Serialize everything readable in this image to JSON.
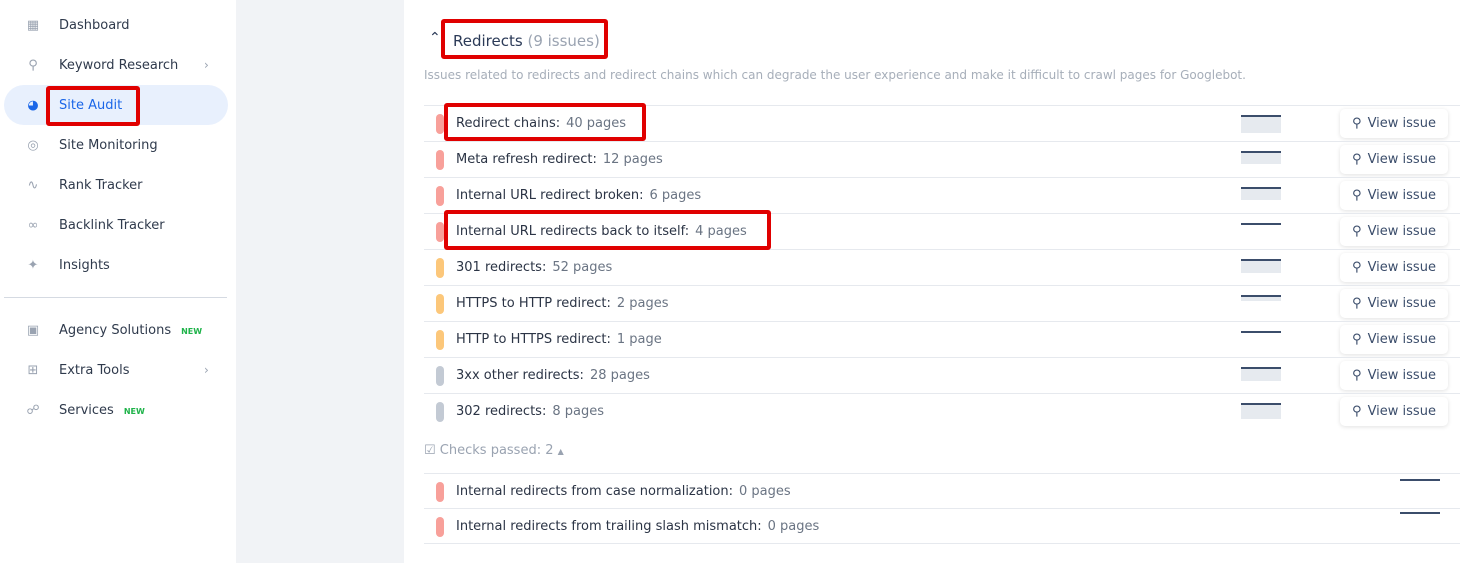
{
  "sidebar": {
    "items": [
      {
        "label": "Dashboard",
        "icon": "dashboard-icon"
      },
      {
        "label": "Keyword Research",
        "icon": "keyword-research-icon",
        "chevron": true
      },
      {
        "label": "Site Audit",
        "icon": "gauge-icon",
        "active": true
      },
      {
        "label": "Site Monitoring",
        "icon": "radar-icon"
      },
      {
        "label": "Rank Tracker",
        "icon": "trend-line-icon"
      },
      {
        "label": "Backlink Tracker",
        "icon": "link-icon"
      },
      {
        "label": "Insights",
        "icon": "magic-wand-icon"
      },
      {
        "label": "Agency Solutions",
        "icon": "briefcase-icon",
        "badge": "NEW"
      },
      {
        "label": "Extra Tools",
        "icon": "grid-plus-icon",
        "chevron": true
      },
      {
        "label": "Services",
        "icon": "nodes-icon",
        "badge": "NEW"
      }
    ]
  },
  "section": {
    "title": "Redirects",
    "count": "(9 issues)",
    "description": "Issues related to redirects and redirect chains which can degrade the user experience and make it difficult to crawl pages for Googlebot.",
    "view_label": "View issue",
    "passed_label": "Checks passed: 2"
  },
  "colors": {
    "error": "#f8a09a",
    "warning": "#fcc77a",
    "notice": "#c3cad4",
    "accent": "#1a66e8",
    "highlight": "#e00000"
  },
  "issues": [
    {
      "name": "Redirect chains:",
      "pages": "40 pages",
      "severity": "error",
      "trend": 1.0
    },
    {
      "name": "Meta refresh redirect:",
      "pages": "12 pages",
      "severity": "error",
      "trend": 0.7
    },
    {
      "name": "Internal URL redirect broken:",
      "pages": "6 pages",
      "severity": "error",
      "trend": 0.7
    },
    {
      "name": "Internal URL redirects back to itself:",
      "pages": "4 pages",
      "severity": "error",
      "trend": 0.0
    },
    {
      "name": "301 redirects:",
      "pages": "52 pages",
      "severity": "warning",
      "trend": 0.8
    },
    {
      "name": "HTTPS to HTTP redirect:",
      "pages": "2 pages",
      "severity": "warning",
      "trend": 0.35
    },
    {
      "name": "HTTP to HTTPS redirect:",
      "pages": "1 page",
      "severity": "warning",
      "trend": 0.1
    },
    {
      "name": "3xx other redirects:",
      "pages": "28 pages",
      "severity": "notice",
      "trend": 0.8
    },
    {
      "name": "302 redirects:",
      "pages": "8 pages",
      "severity": "notice",
      "trend": 0.9
    }
  ],
  "passed": [
    {
      "name": "Internal redirects from case normalization:",
      "pages": "0 pages",
      "severity": "error"
    },
    {
      "name": "Internal redirects from trailing slash mismatch:",
      "pages": "0 pages",
      "severity": "error"
    }
  ]
}
